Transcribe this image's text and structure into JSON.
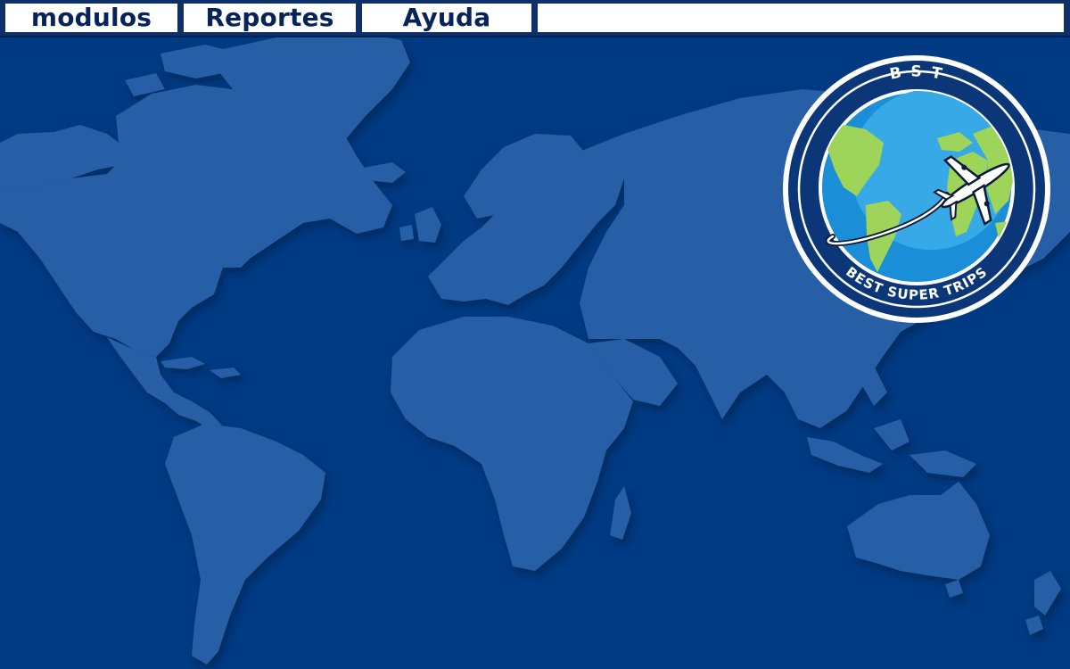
{
  "menu": {
    "items": [
      {
        "label": "modulos"
      },
      {
        "label": "Reportes"
      },
      {
        "label": "Ayuda"
      }
    ]
  },
  "logo": {
    "top_text": "B S T",
    "bottom_text": "BEST SUPER TRIPS"
  },
  "colors": {
    "background": "#003a82",
    "land": "#275ea6",
    "menubar": "#0d2f6a",
    "menu_text": "#07245a",
    "logo_navy": "#0b3678",
    "ocean_light": "#36a9e6",
    "continent_green": "#9fd45a"
  },
  "icons": [
    "world-map-background",
    "globe-icon",
    "airplane-icon"
  ]
}
